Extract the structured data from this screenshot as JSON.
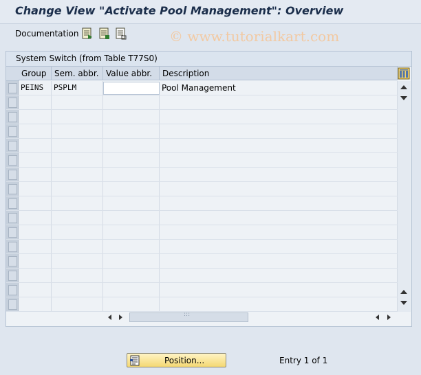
{
  "title": "Change View \"Activate Pool Management\": Overview",
  "toolbar": {
    "documentation_label": "Documentation",
    "icons": [
      "select-all-icon",
      "deselect-all-icon",
      "select-block-icon"
    ]
  },
  "watermark": "© www.tutorialkart.com",
  "panel": {
    "title": "System Switch (from Table T77S0)",
    "columns": [
      "Group",
      "Sem. abbr.",
      "Value abbr.",
      "Description"
    ],
    "rows": [
      {
        "group": "PEINS",
        "sem_abbr": "PSPLM",
        "value_abbr": "",
        "description": "Pool Management"
      },
      {
        "group": "",
        "sem_abbr": "",
        "value_abbr": "",
        "description": ""
      },
      {
        "group": "",
        "sem_abbr": "",
        "value_abbr": "",
        "description": ""
      },
      {
        "group": "",
        "sem_abbr": "",
        "value_abbr": "",
        "description": ""
      },
      {
        "group": "",
        "sem_abbr": "",
        "value_abbr": "",
        "description": ""
      },
      {
        "group": "",
        "sem_abbr": "",
        "value_abbr": "",
        "description": ""
      },
      {
        "group": "",
        "sem_abbr": "",
        "value_abbr": "",
        "description": ""
      },
      {
        "group": "",
        "sem_abbr": "",
        "value_abbr": "",
        "description": ""
      },
      {
        "group": "",
        "sem_abbr": "",
        "value_abbr": "",
        "description": ""
      },
      {
        "group": "",
        "sem_abbr": "",
        "value_abbr": "",
        "description": ""
      },
      {
        "group": "",
        "sem_abbr": "",
        "value_abbr": "",
        "description": ""
      },
      {
        "group": "",
        "sem_abbr": "",
        "value_abbr": "",
        "description": ""
      },
      {
        "group": "",
        "sem_abbr": "",
        "value_abbr": "",
        "description": ""
      },
      {
        "group": "",
        "sem_abbr": "",
        "value_abbr": "",
        "description": ""
      },
      {
        "group": "",
        "sem_abbr": "",
        "value_abbr": "",
        "description": ""
      },
      {
        "group": "",
        "sem_abbr": "",
        "value_abbr": "",
        "description": ""
      }
    ]
  },
  "footer": {
    "position_label": "Position...",
    "entry_text": "Entry 1 of 1"
  }
}
